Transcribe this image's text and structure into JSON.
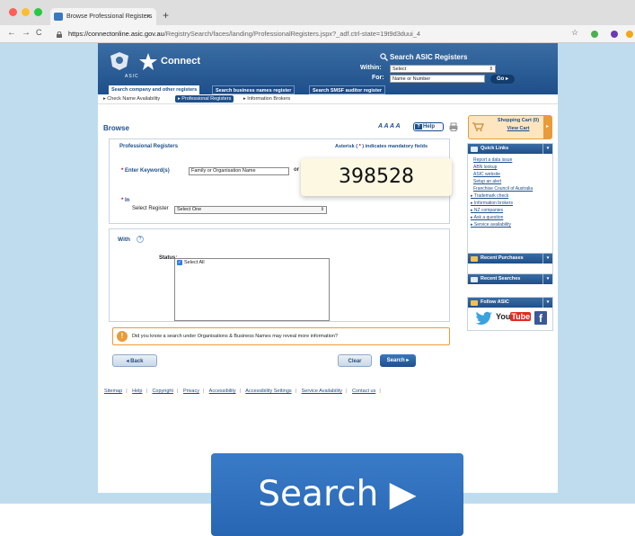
{
  "browser": {
    "tab_title": "Browse Professional Registers",
    "tab_close": "×",
    "new_tab": "+",
    "url_domain": "https://connectonline.asic.gov.au",
    "url_path": "/RegistrySearch/faces/landing/ProfessionalRegisters.jspx?_adf.ctrl-state=19t9d3duui_4",
    "nav_back": "←",
    "nav_forward": "→",
    "nav_reload": "C",
    "star": "☆"
  },
  "header": {
    "logo_text": "Connect",
    "logo_sub": "ASIC",
    "search_title": "Search ASIC Registers",
    "within_label": "Within:",
    "within_value": "Select",
    "for_label": "For:",
    "for_placeholder": "Name or Number",
    "go_label": "Go ▸"
  },
  "tabs": [
    {
      "label": "Search company and other registers"
    },
    {
      "label": "Search business names register"
    },
    {
      "label": "Search SMSF auditor register"
    }
  ],
  "subnav": [
    {
      "label": "▸ Check Name Availability"
    },
    {
      "label": "▸ Professional Registers"
    },
    {
      "label": "▸ Information Brokers"
    }
  ],
  "page": {
    "browse_title": "Browse",
    "text_size": "A A A A",
    "help_label": "Help",
    "cart_title": "Shopping Cart (0)",
    "cart_view": "View Cart",
    "section_title": "Professional Registers",
    "mandatory_pre": "Asterisk (",
    "mandatory_star": " * ",
    "mandatory_post": ") indicates mandatory fields",
    "keyword_star": "* ",
    "keyword_label": "Enter Keyword(s)",
    "keyword_value": "Family or Organisation Name",
    "or_label": "or",
    "in_star": "* ",
    "in_label": "In",
    "select_register_label": "Select Register",
    "select_register_value": "Select One",
    "with_label": "With",
    "with_help": "?",
    "status_label": "Status:",
    "select_all": "Select All",
    "tip_icon": "!",
    "tip_text": "Did you know a search under Organisations & Business Names may reveal more information?",
    "back_label": "◂ Back",
    "clear_label": "Clear",
    "search_label": "Search ▸"
  },
  "quick_links": {
    "title": "Quick Links",
    "items": [
      "Report a data issue",
      "ABN lookup",
      "ASIC website",
      "Setup an alert",
      "Franchise Council of Australia",
      "▸ Trademark check",
      "▸ Information brokers",
      "▸ NZ companies",
      "▸ Ask a question",
      "▸ Service availability"
    ]
  },
  "sidebar_boxes": {
    "recent_purchases": "Recent Purchases",
    "recent_searches": "Recent Searches",
    "follow": "Follow ASIC",
    "youtube": "You Tube"
  },
  "footer": [
    "Sitemap",
    "Help",
    "Copyright",
    "Privacy",
    "Accessibility",
    "Accessibility Settings",
    "Service Availability",
    "Contact us"
  ],
  "tooltip_value": "398528",
  "zoom_button": "Search ▶",
  "colors": {
    "brand": "#1e4f8a",
    "accent": "#e99b3a",
    "required": "#d4001c"
  }
}
